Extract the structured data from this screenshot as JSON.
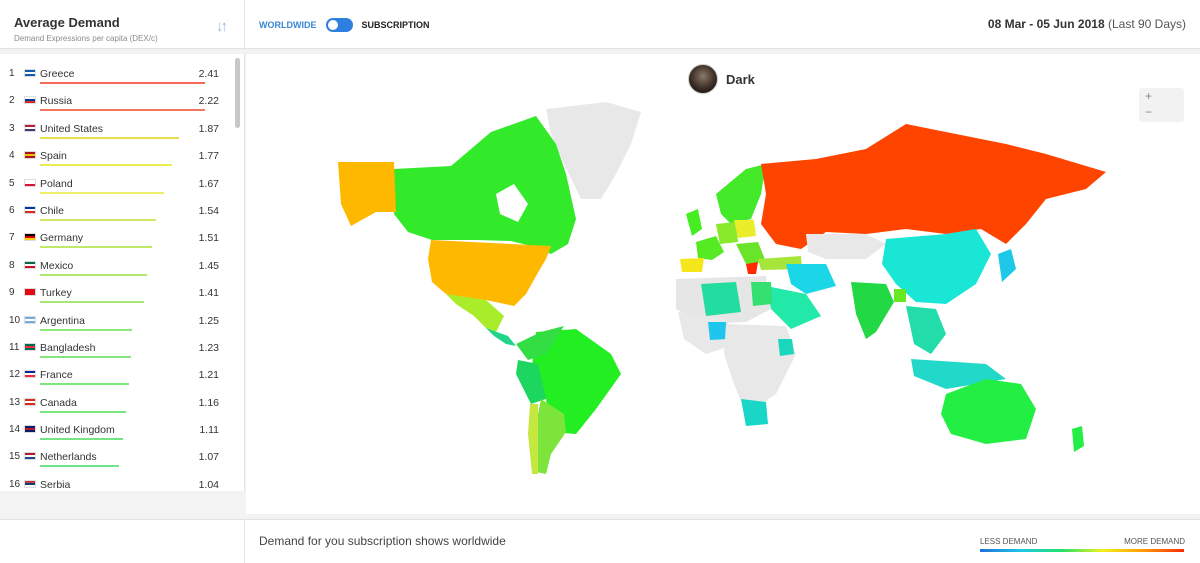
{
  "header": {
    "panel_title": "Average Demand",
    "panel_subtitle": "Demand Expressions per capita (DEX/c)",
    "toggle_left": "WORLDWIDE",
    "toggle_right": "SUBSCRIPTION",
    "date_range": "08 Mar - 05 Jun 2018",
    "period": "(Last 90 Days)"
  },
  "show": {
    "title": "Dark"
  },
  "zoom": {
    "in": "+",
    "out": "−"
  },
  "colors": {
    "accent": "#2f7fe0",
    "toggle_active_text": "#3a86d4"
  },
  "ranking": [
    {
      "rank": "1",
      "country": "Greece",
      "value": "2.41",
      "bar_fraction": 1.0,
      "bar_color": "#f36a5a",
      "flag": [
        "#0d5eaf",
        "#ffffff",
        "#0d5eaf"
      ]
    },
    {
      "rank": "2",
      "country": "Russia",
      "value": "2.22",
      "bar_fraction": 1.0,
      "bar_color": "#f47860",
      "flag": [
        "#ffffff",
        "#0039a6",
        "#d52b1e"
      ]
    },
    {
      "rank": "3",
      "country": "United States",
      "value": "1.87",
      "bar_fraction": 0.84,
      "bar_color": "#e8df4a",
      "flag": [
        "#b22234",
        "#ffffff",
        "#3c3b6e"
      ]
    },
    {
      "rank": "4",
      "country": "Spain",
      "value": "1.77",
      "bar_fraction": 0.8,
      "bar_color": "#eaed52",
      "flag": [
        "#aa151b",
        "#f1bf00",
        "#aa151b"
      ]
    },
    {
      "rank": "5",
      "country": "Poland",
      "value": "1.67",
      "bar_fraction": 0.75,
      "bar_color": "#eef06a",
      "flag": [
        "#ffffff",
        "#ffffff",
        "#dc143c"
      ]
    },
    {
      "rank": "6",
      "country": "Chile",
      "value": "1.54",
      "bar_fraction": 0.7,
      "bar_color": "#cfe866",
      "flag": [
        "#0039a6",
        "#ffffff",
        "#d52b1e"
      ]
    },
    {
      "rank": "7",
      "country": "Germany",
      "value": "1.51",
      "bar_fraction": 0.68,
      "bar_color": "#c2e86a",
      "flag": [
        "#000000",
        "#dd0000",
        "#ffce00"
      ]
    },
    {
      "rank": "8",
      "country": "Mexico",
      "value": "1.45",
      "bar_fraction": 0.65,
      "bar_color": "#b0e870",
      "flag": [
        "#006847",
        "#ffffff",
        "#ce1126"
      ]
    },
    {
      "rank": "9",
      "country": "Turkey",
      "value": "1.41",
      "bar_fraction": 0.63,
      "bar_color": "#a7e872",
      "flag": [
        "#e30a17",
        "#e30a17",
        "#e30a17"
      ]
    },
    {
      "rank": "10",
      "country": "Argentina",
      "value": "1.25",
      "bar_fraction": 0.56,
      "bar_color": "#8be87a",
      "flag": [
        "#74acdf",
        "#ffffff",
        "#74acdf"
      ]
    },
    {
      "rank": "11",
      "country": "Bangladesh",
      "value": "1.23",
      "bar_fraction": 0.55,
      "bar_color": "#86e67c",
      "flag": [
        "#006a4e",
        "#f42a41",
        "#006a4e"
      ]
    },
    {
      "rank": "12",
      "country": "France",
      "value": "1.21",
      "bar_fraction": 0.54,
      "bar_color": "#80e67e",
      "flag": [
        "#002395",
        "#ffffff",
        "#ed2939"
      ]
    },
    {
      "rank": "13",
      "country": "Canada",
      "value": "1.16",
      "bar_fraction": 0.52,
      "bar_color": "#7ae680",
      "flag": [
        "#d52b1e",
        "#ffffff",
        "#d52b1e"
      ]
    },
    {
      "rank": "14",
      "country": "United Kingdom",
      "value": "1.11",
      "bar_fraction": 0.5,
      "bar_color": "#74e484",
      "flag": [
        "#012169",
        "#c8102e",
        "#012169"
      ]
    },
    {
      "rank": "15",
      "country": "Netherlands",
      "value": "1.07",
      "bar_fraction": 0.48,
      "bar_color": "#70e488",
      "flag": [
        "#ae1c28",
        "#ffffff",
        "#21468b"
      ]
    },
    {
      "rank": "16",
      "country": "Serbia",
      "value": "1.04",
      "bar_fraction": 0.46,
      "bar_color": "#6ce48c",
      "flag": [
        "#c6363c",
        "#0c4076",
        "#ffffff"
      ]
    }
  ],
  "footer": {
    "caption": "Demand for you subscription shows worldwide",
    "legend_less": "LESS DEMAND",
    "legend_more": "MORE DEMAND"
  }
}
